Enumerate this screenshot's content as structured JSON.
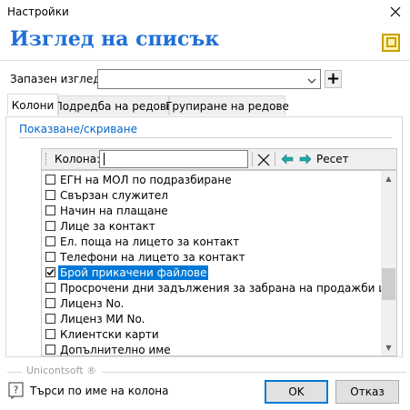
{
  "window": {
    "title": "Настройки",
    "heading": "Изглед на списък"
  },
  "saved_view": {
    "label": "Запазен изглед:",
    "value": "",
    "add_symbol": "+"
  },
  "tabs": [
    {
      "label": "Колони",
      "active": true
    },
    {
      "label": "Подредба на редове",
      "active": false
    },
    {
      "label": "Групиране на редове",
      "active": false
    }
  ],
  "section_link": "Показване/скриване",
  "filter": {
    "label": "Колона:",
    "value": "",
    "reset_label": "Ресет"
  },
  "columns": [
    {
      "label": "ЕГН на МОЛ по подразбиране",
      "checked": false,
      "selected": false
    },
    {
      "label": "Свързан служител",
      "checked": false,
      "selected": false
    },
    {
      "label": "Начин на плащане",
      "checked": false,
      "selected": false
    },
    {
      "label": "Лице за контакт",
      "checked": false,
      "selected": false
    },
    {
      "label": "Ел. поща на лицето за контакт",
      "checked": false,
      "selected": false
    },
    {
      "label": "Телефони на лицето за контакт",
      "checked": false,
      "selected": false
    },
    {
      "label": "Брой прикачени файлове",
      "checked": true,
      "selected": true
    },
    {
      "label": "Просрочени дни задължения за забрана на продажби и заявки",
      "checked": false,
      "selected": false
    },
    {
      "label": "Лиценз No.",
      "checked": false,
      "selected": false
    },
    {
      "label": "Лиценз МИ No.",
      "checked": false,
      "selected": false
    },
    {
      "label": "Клиентски карти",
      "checked": false,
      "selected": false
    },
    {
      "label": "Допълнително име",
      "checked": false,
      "selected": false
    }
  ],
  "footer": {
    "brand": "Unicontsoft ®",
    "hint": "Търси по име на колона",
    "ok_label": "OK",
    "cancel_label": "Отказ"
  },
  "colors": {
    "heading": "#1f6fd6",
    "link": "#0066cc",
    "selection": "#0078d7",
    "arrow": "#20a8a8",
    "icon_gold": "#c8a000"
  }
}
